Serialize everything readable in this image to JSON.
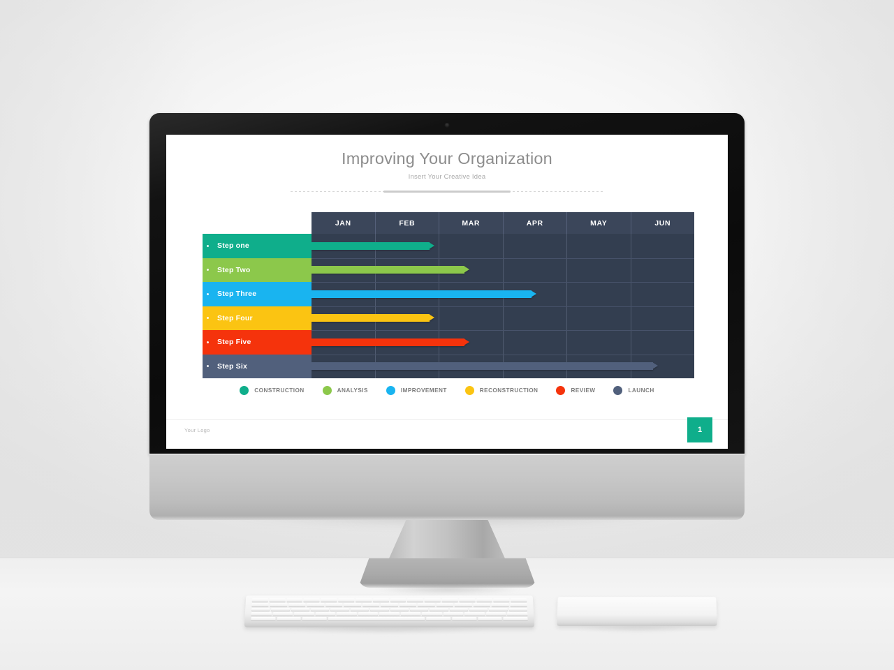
{
  "slide": {
    "title": "Improving Your Organization",
    "subtitle": "Insert Your Creative Idea",
    "logo": "Your Logo",
    "page_number": "1"
  },
  "chart_data": {
    "type": "bar",
    "title": "Improving Your Organization",
    "subtitle": "Insert Your Creative Idea",
    "orientation": "horizontal",
    "xlabel": "",
    "ylabel": "",
    "categories": [
      "Step one",
      "Step Two",
      "Step Three",
      "Step Four",
      "Step Five",
      "Step Six"
    ],
    "x_tick_labels": [
      "JAN",
      "FEB",
      "MAR",
      "APR",
      "MAY",
      "JUN"
    ],
    "x_axis_units": "month",
    "xlim": [
      0,
      6
    ],
    "grid": true,
    "legend_position": "bottom",
    "series": [
      {
        "name": "CONSTRUCTION",
        "category": "Step one",
        "color": "#0fae8b",
        "start": 0,
        "end": 1.85,
        "start_month": "JAN",
        "end_month": "FEB"
      },
      {
        "name": "ANALYSIS",
        "category": "Step Two",
        "color": "#8cc84b",
        "start": 0,
        "end": 2.4,
        "start_month": "JAN",
        "end_month": "MAR"
      },
      {
        "name": "IMPROVEMENT",
        "category": "Step Three",
        "color": "#19b4f0",
        "start": 0,
        "end": 3.45,
        "start_month": "JAN",
        "end_month": "APR"
      },
      {
        "name": "RECONSTRUCTION",
        "category": "Step Four",
        "color": "#fbc412",
        "start": 0,
        "end": 1.85,
        "start_month": "JAN",
        "end_month": "FEB"
      },
      {
        "name": "REVIEW",
        "category": "Step Five",
        "color": "#f5330c",
        "start": 0,
        "end": 2.4,
        "start_month": "JAN",
        "end_month": "MAR"
      },
      {
        "name": "LAUNCH",
        "category": "Step Six",
        "color": "#51607c",
        "start": 0,
        "end": 5.35,
        "start_month": "JAN",
        "end_month": "JUN"
      }
    ]
  },
  "steps": [
    {
      "label": "Step one",
      "color": "#0fae8b",
      "bar_pct": 30.8
    },
    {
      "label": "Step Two",
      "color": "#8cc84b",
      "bar_pct": 40.0
    },
    {
      "label": "Step Three",
      "color": "#19b4f0",
      "bar_pct": 57.5
    },
    {
      "label": "Step Four",
      "color": "#fbc412",
      "bar_pct": 30.8
    },
    {
      "label": "Step Five",
      "color": "#f5330c",
      "bar_pct": 40.0
    },
    {
      "label": "Step Six",
      "color": "#51607c",
      "bar_pct": 89.2
    }
  ],
  "months": [
    "JAN",
    "FEB",
    "MAR",
    "APR",
    "MAY",
    "JUN"
  ],
  "legend": [
    {
      "label": "CONSTRUCTION",
      "color": "#0fae8b"
    },
    {
      "label": "ANALYSIS",
      "color": "#8cc84b"
    },
    {
      "label": "IMPROVEMENT",
      "color": "#19b4f0"
    },
    {
      "label": "RECONSTRUCTION",
      "color": "#fbc412"
    },
    {
      "label": "REVIEW",
      "color": "#f5330c"
    },
    {
      "label": "LAUNCH",
      "color": "#51607c"
    }
  ],
  "theme": {
    "table_bg": "#333e50",
    "table_header_bg": "#3b465a",
    "grid_line": "#505b70",
    "accent": "#0fae8b",
    "title_color": "#8d8d8d",
    "subtitle_color": "#a9a9a9"
  }
}
